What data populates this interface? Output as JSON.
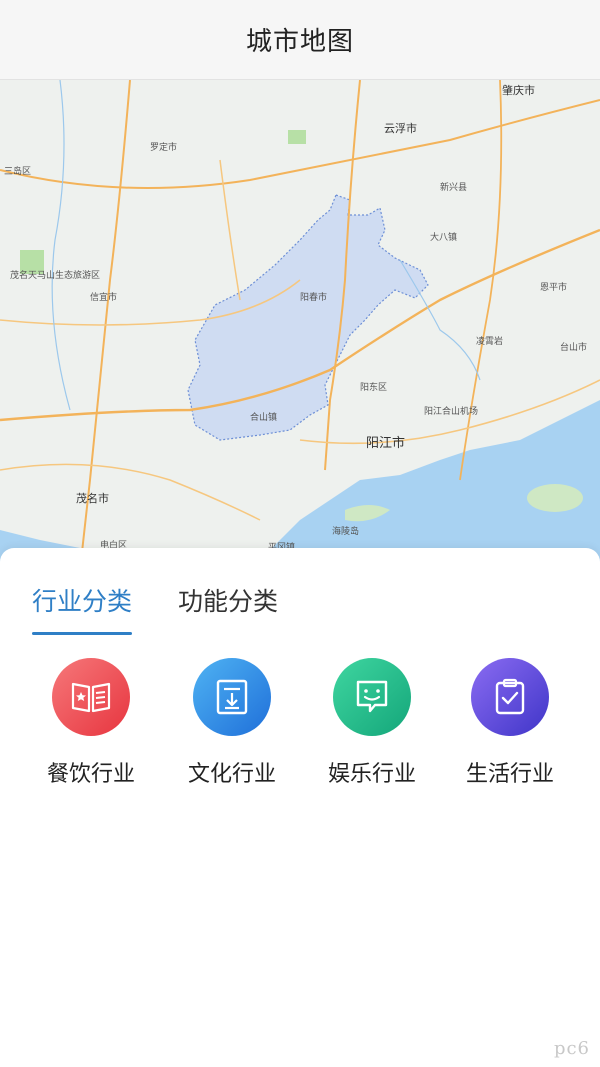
{
  "header": {
    "title": "城市地图"
  },
  "map": {
    "labels": [
      "云浮市",
      "肇庆市",
      "阳江市",
      "茂名市",
      "电白区",
      "海陵岛",
      "阳江合山机场",
      "三岛区",
      "茂名天马山生态旅游区",
      "凌霄岩",
      "大八镇",
      "罗定市",
      "信宜市",
      "新兴县",
      "恩平市",
      "台山市",
      "阳春市",
      "阳东区",
      "合山镇",
      "平冈镇"
    ],
    "highlight_color": "#c9d8f2",
    "highlight_border": "#6d8fd6"
  },
  "tabs": [
    {
      "label": "行业分类",
      "active": true
    },
    {
      "label": "功能分类",
      "active": false
    }
  ],
  "categories": [
    {
      "label": "餐饮行业",
      "icon": "menu-book-icon",
      "color_from": "#f6787a",
      "color_to": "#e7353f"
    },
    {
      "label": "文化行业",
      "icon": "document-download-icon",
      "color_from": "#4fb3f3",
      "color_to": "#1f6fd9"
    },
    {
      "label": "娱乐行业",
      "icon": "smile-chat-icon",
      "color_from": "#3fd6a0",
      "color_to": "#14a67a"
    },
    {
      "label": "生活行业",
      "icon": "clipboard-check-icon",
      "color_from": "#8b6cf2",
      "color_to": "#3f35c8"
    }
  ],
  "watermark": "pc6"
}
